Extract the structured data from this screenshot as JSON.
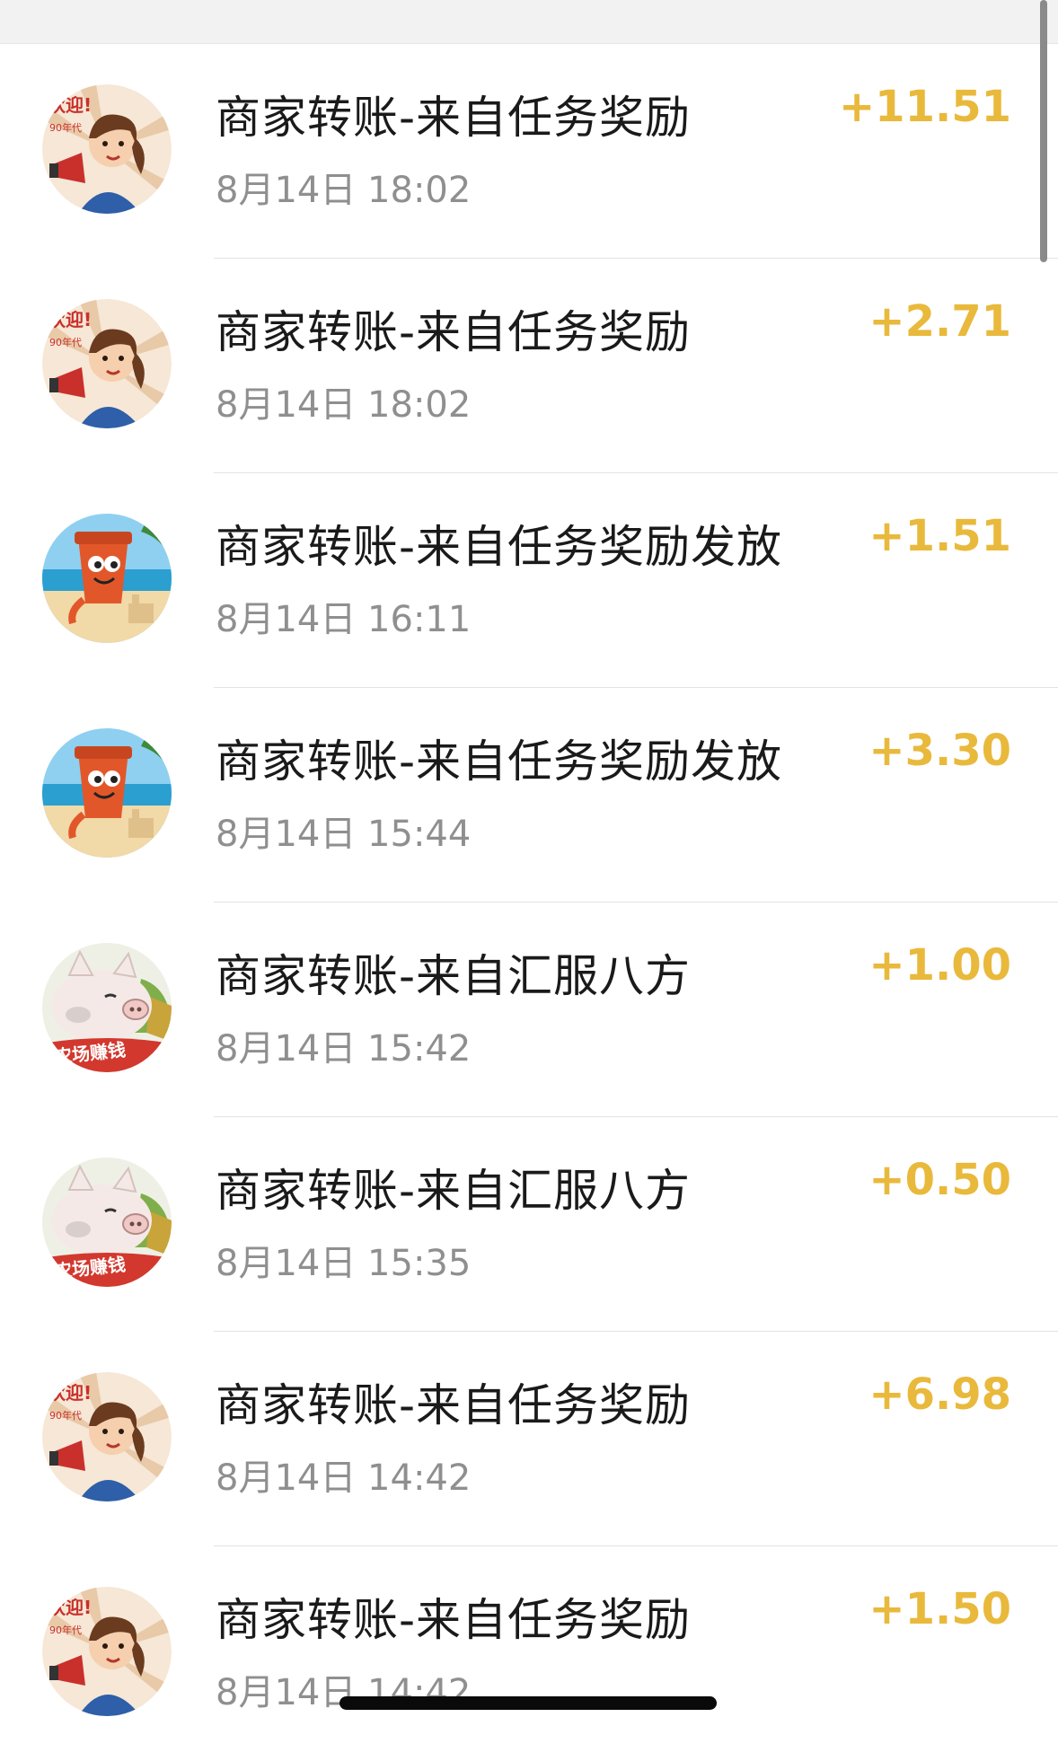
{
  "colors": {
    "amount": "#e9b93c",
    "title": "#1a1a1a",
    "time": "#8f8f8f",
    "divider": "#e3e3e3"
  },
  "transactions": [
    {
      "title": "商家转账-来自任务奖励",
      "time": "8月14日 18:02",
      "amount": "+11.51",
      "avatar": "girl-megaphone-avatar"
    },
    {
      "title": "商家转账-来自任务奖励",
      "time": "8月14日 18:02",
      "amount": "+2.71",
      "avatar": "girl-megaphone-avatar"
    },
    {
      "title": "商家转账-来自任务奖励发放",
      "time": "8月14日 16:11",
      "amount": "+1.51",
      "avatar": "flowerpot-beach-avatar"
    },
    {
      "title": "商家转账-来自任务奖励发放",
      "time": "8月14日 15:44",
      "amount": "+3.30",
      "avatar": "flowerpot-beach-avatar"
    },
    {
      "title": "商家转账-来自汇服八方",
      "time": "8月14日 15:42",
      "amount": "+1.00",
      "avatar": "pig-farm-avatar"
    },
    {
      "title": "商家转账-来自汇服八方",
      "time": "8月14日 15:35",
      "amount": "+0.50",
      "avatar": "pig-farm-avatar"
    },
    {
      "title": "商家转账-来自任务奖励",
      "time": "8月14日 14:42",
      "amount": "+6.98",
      "avatar": "girl-megaphone-avatar"
    },
    {
      "title": "商家转账-来自任务奖励",
      "time": "8月14日 14:42",
      "amount": "+1.50",
      "avatar": "girl-megaphone-avatar"
    }
  ],
  "avatar_text": {
    "girl": "欢迎!",
    "girl_sub": "90年代",
    "pig": "农场赚钱"
  }
}
